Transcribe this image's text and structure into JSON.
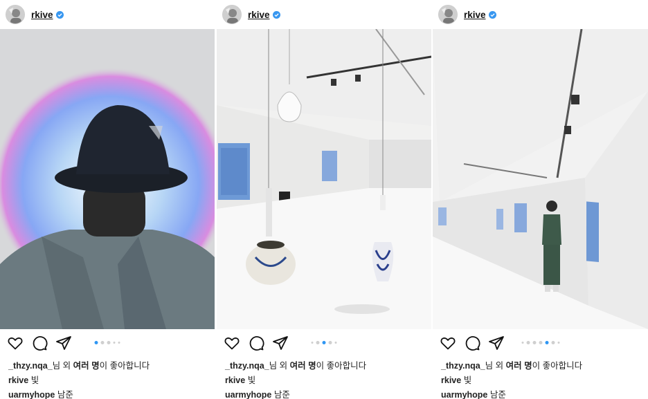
{
  "posts": [
    {
      "username": "rkive",
      "liked_by_user": "_thzy.nqa_",
      "liked_mid": "님 외 ",
      "liked_bold": "여러 명",
      "liked_end": "이 좋아합니다",
      "caption_user": "rkive",
      "caption_text": "빛",
      "comment_user": "uarmyhope",
      "comment_text": "남준",
      "carousel_index": 1,
      "carousel_total": 5
    },
    {
      "username": "rkive",
      "liked_by_user": "_thzy.nqa_",
      "liked_mid": "님 외 ",
      "liked_bold": "여러 명",
      "liked_end": "이 좋아합니다",
      "caption_user": "rkive",
      "caption_text": "빛",
      "comment_user": "uarmyhope",
      "comment_text": "남준",
      "carousel_index": 3,
      "carousel_total": 5
    },
    {
      "username": "rkive",
      "liked_by_user": "_thzy.nqa_",
      "liked_mid": "님 외 ",
      "liked_bold": "여러 명",
      "liked_end": "이 좋아합니다",
      "caption_user": "rkive",
      "caption_text": "빛",
      "comment_user": "uarmyhope",
      "comment_text": "남준",
      "carousel_index": 5,
      "carousel_total": 7
    }
  ],
  "icons": {
    "like": "heart-icon",
    "comment": "comment-icon",
    "share": "send-icon",
    "verified": "verified-badge-icon"
  },
  "colors": {
    "accent": "#2f96f3",
    "verified": "#3897f0"
  }
}
